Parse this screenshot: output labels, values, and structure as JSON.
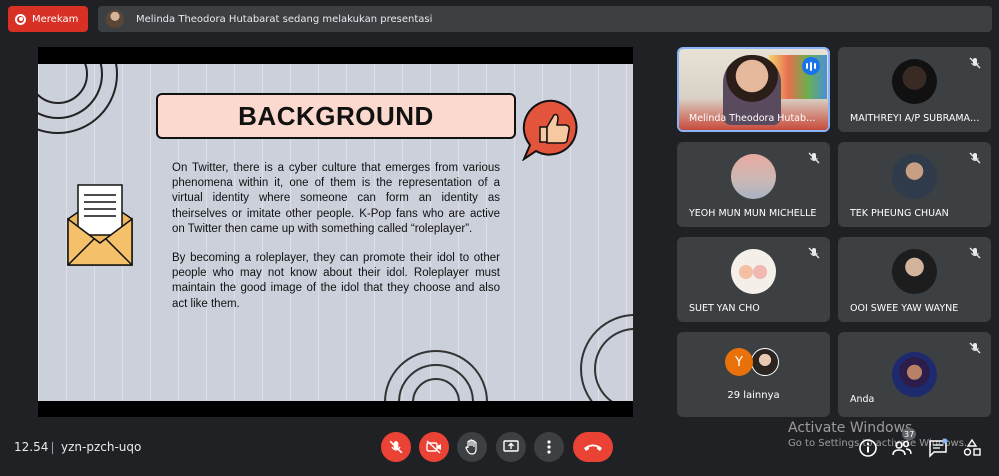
{
  "top_bar": {
    "record_label": "Merekam",
    "presenting_text": "Melinda Theodora Hutabarat sedang melakukan presentasi"
  },
  "slide": {
    "title": "BACKGROUND",
    "paragraph_1": "On Twitter, there is a cyber culture that emerges from various phenomena within it, one of them is the representation of a virtual identity where someone can form an identity as theirselves or imitate other people. K-Pop fans who are active on Twitter then came up with something called “roleplayer”.",
    "paragraph_2": "By becoming a roleplayer, they can promote their idol to other people who may not know about their idol. Roleplayer must maintain the good image of the idol that they choose and also act like them."
  },
  "participants": [
    {
      "name": "Melinda Theodora Hutabarat",
      "speaking": true
    },
    {
      "name": "MAITHREYI A/P SUBRAMANIAM",
      "muted": true
    },
    {
      "name": "YEOH MUN MUN MICHELLE",
      "muted": true
    },
    {
      "name": "TEK PHEUNG CHUAN",
      "muted": true
    },
    {
      "name": "SUET YAN CHO",
      "muted": true
    },
    {
      "name": "OOI SWEE YAW WAYNE",
      "muted": true
    },
    {
      "name": "29 lainnya",
      "avatar_letter": "Y"
    },
    {
      "name": "Anda",
      "muted": true
    }
  ],
  "bottom_bar": {
    "time": "12.54",
    "meeting_code": "yzn-pzch-uqo",
    "participant_count": "37"
  },
  "watermark": {
    "line1": "Activate Windows",
    "line2": "Go to Settings to activate Windows."
  },
  "colors": {
    "background": "#202124",
    "tile": "#3c4043",
    "danger": "#ea4335",
    "accent_blue": "#8ab4f8"
  }
}
